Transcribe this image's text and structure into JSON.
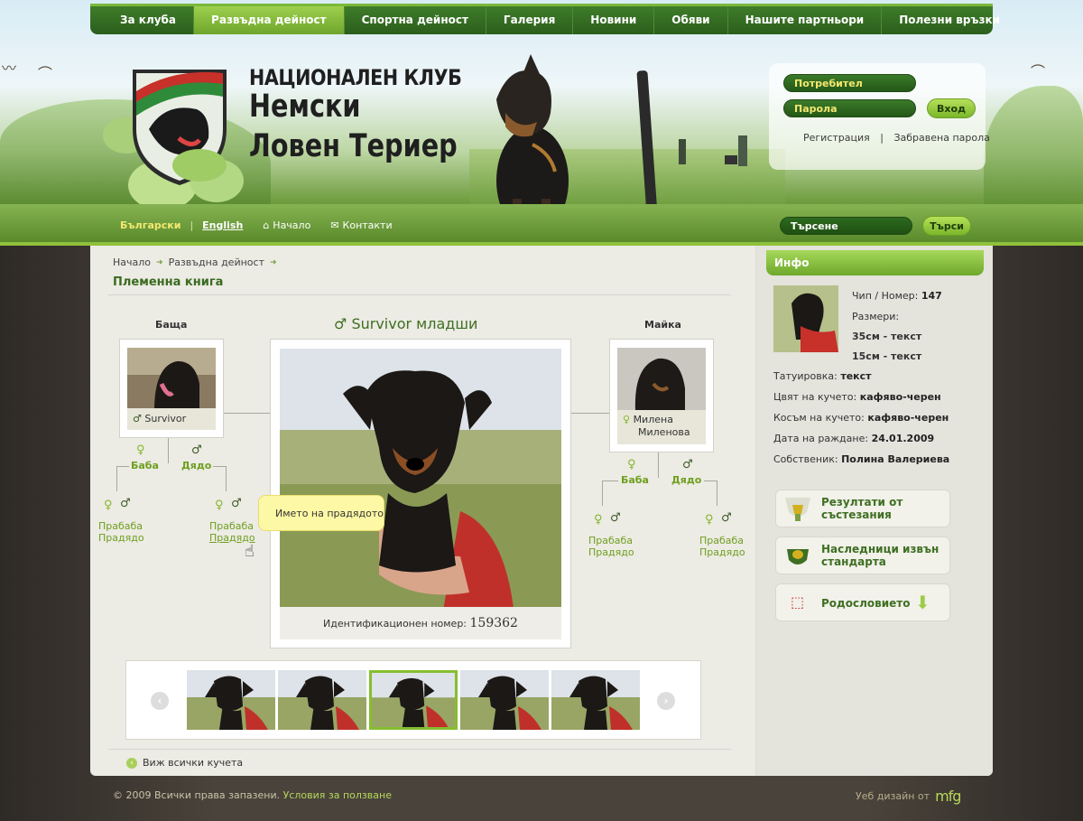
{
  "nav": [
    "За клуба",
    "Развъдна дейност",
    "Спортна дейност",
    "Галерия",
    "Новини",
    "Обяви",
    "Нашите партньори",
    "Полезни връзки"
  ],
  "nav_active": 1,
  "header": {
    "title_line1": "НАЦИОНАЛЕН КЛУБ",
    "title_line2": "Немски",
    "title_line3": "Ловен Териер"
  },
  "login": {
    "user_placeholder": "Потребител",
    "pass_placeholder": "Парола",
    "submit": "Вход",
    "register": "Регистрация",
    "separator": "|",
    "forgot": "Забравена парола"
  },
  "lang": {
    "bg": "Български",
    "sep": "|",
    "en": "English",
    "home": "Начало",
    "contacts": "Контакти"
  },
  "search": {
    "placeholder": "Търсене",
    "button": "Търси"
  },
  "breadcrumb": [
    "Начало",
    "Развъдна дейност"
  ],
  "page_title": "Племенна книга",
  "pedigree": {
    "father_label": "Баща",
    "mother_label": "Майка",
    "dog_name": "Survivor младши",
    "father_name": "Survivor",
    "mother_name_1": "Милена",
    "mother_name_2": "Миленова",
    "grandma": "Баба",
    "grandpa": "Дядо",
    "greatgrandma": "Прабаба",
    "greatgrandpa": "Прадядо",
    "id_label": "Идентификационен номер:",
    "id_value": "159362",
    "tooltip": "Името на прадядото"
  },
  "view_all": "Виж всички кучета",
  "info": {
    "tab": "Инфо",
    "chip_label": "Чип / Номер:",
    "chip_value": "147",
    "sizes_label": "Размери:",
    "size1": "35см - текст",
    "size2": "15см - текст",
    "tattoo_label": "Татуировка:",
    "tattoo_value": "текст",
    "color_label": "Цвят на кучето:",
    "color_value": "кафяво-черен",
    "coat_label": "Косъм на кучето:",
    "coat_value": "кафяво-черен",
    "birth_label": "Дата на раждане:",
    "birth_value": "24.01.2009",
    "owner_label": "Собственик:",
    "owner_value": "Полина Валериева",
    "box1_l1": "Резултати от",
    "box1_l2": "състезания",
    "box2_l1": "Наследници извън",
    "box2_l2": "стандарта",
    "box3": "Родословието"
  },
  "footer": {
    "copyright": "© 2009 Всички права запазени.",
    "terms": "Условия за ползване",
    "design": "Уеб дизайн  от",
    "design_logo": "mfg"
  },
  "colors": {
    "accent": "#7bb72a",
    "dark_green": "#2b5e1c",
    "text_green": "#3a6b1f"
  }
}
